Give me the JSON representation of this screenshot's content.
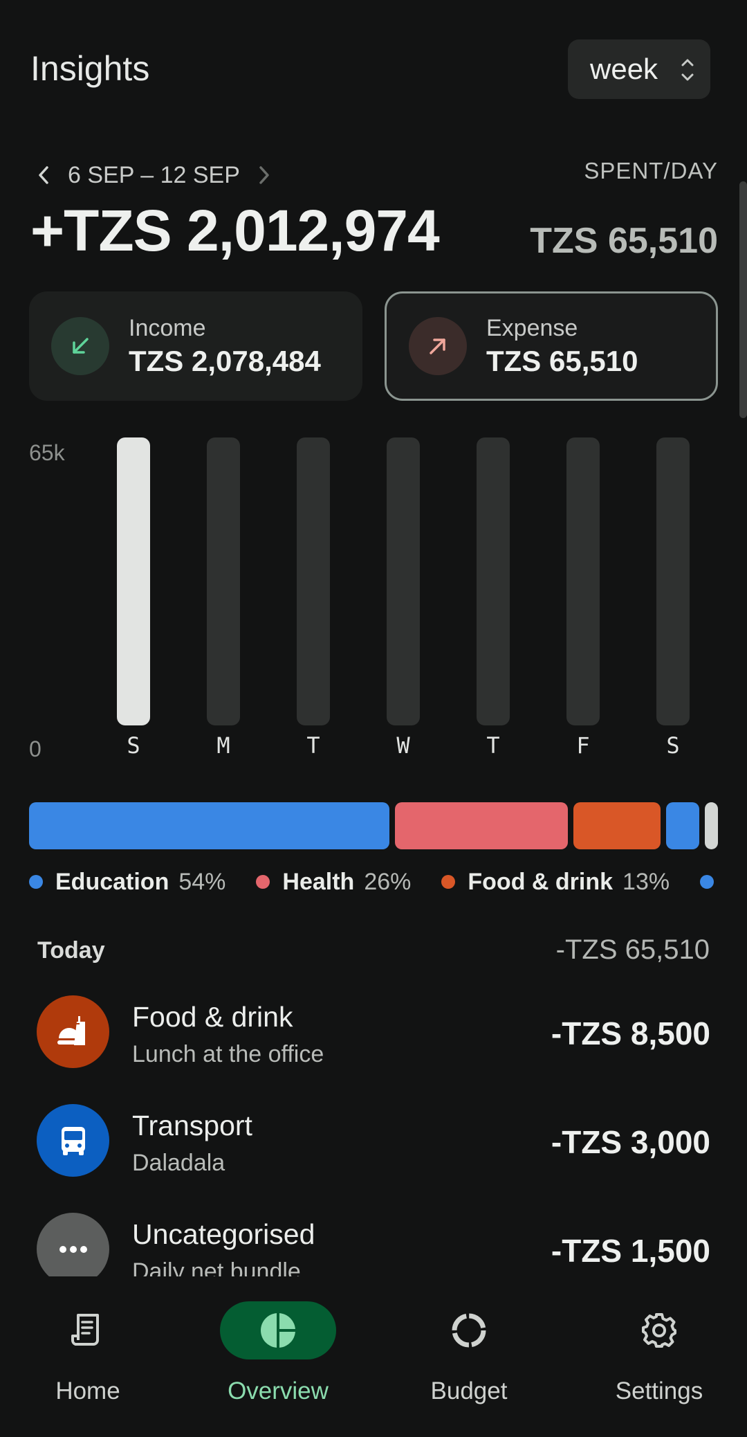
{
  "header": {
    "title": "Insights",
    "period_label": "week"
  },
  "summary": {
    "range": "6 SEP – 12 SEP",
    "net_total": "+TZS 2,012,974",
    "spent_per_day_label": "SPENT/DAY",
    "spent_per_day_value": "TZS 65,510",
    "income_label": "Income",
    "income_value": "TZS 2,078,484",
    "expense_label": "Expense",
    "expense_value": "TZS 65,510",
    "selected": "expense"
  },
  "chart_data": {
    "type": "bar",
    "categories": [
      "S",
      "M",
      "T",
      "W",
      "T",
      "F",
      "S"
    ],
    "values": [
      65510,
      0,
      0,
      0,
      0,
      0,
      0
    ],
    "y_tick_labels": [
      "65k",
      "0"
    ],
    "ylim": [
      0,
      65510
    ],
    "grid": false,
    "bar_color": "#e2e4e2",
    "track_color": "#2f3130"
  },
  "category_split": [
    {
      "name": "Education",
      "percent": 54,
      "percent_text": "54%",
      "color": "#3a87e4"
    },
    {
      "name": "Health",
      "percent": 26,
      "percent_text": "26%",
      "color": "#e4666c"
    },
    {
      "name": "Food & drink",
      "percent": 13,
      "percent_text": "13%",
      "color": "#d95727"
    },
    {
      "name": "",
      "percent": 5,
      "percent_text": "",
      "color": "#3a87e4"
    },
    {
      "name": "",
      "percent": 2,
      "percent_text": "",
      "color": "#d3d6d3"
    }
  ],
  "today": {
    "label": "Today",
    "total": "-TZS 65,510"
  },
  "transactions": [
    {
      "category": "Food & drink",
      "note": "Lunch at the office",
      "amount": "-TZS 8,500",
      "icon": "food-icon",
      "color": "#b03a0c"
    },
    {
      "category": "Transport",
      "note": "Daladala",
      "amount": "-TZS 3,000",
      "icon": "bus-icon",
      "color": "#0c5fc1"
    },
    {
      "category": "Uncategorised",
      "note": "Daily net bundle",
      "amount": "-TZS 1,500",
      "icon": "more-icon",
      "color": "#5c5e5d"
    }
  ],
  "nav": [
    {
      "label": "Home",
      "icon": "receipt-icon",
      "active": false
    },
    {
      "label": "Overview",
      "icon": "pie-chart-icon",
      "active": true
    },
    {
      "label": "Budget",
      "icon": "donut-icon",
      "active": false
    },
    {
      "label": "Settings",
      "icon": "gear-icon",
      "active": false
    }
  ],
  "colors": {
    "background": "#121313",
    "accent": "#045d32",
    "accent_text": "#8bdcae",
    "income_icon": "#5fd49a",
    "expense_icon": "#f0a79b"
  }
}
